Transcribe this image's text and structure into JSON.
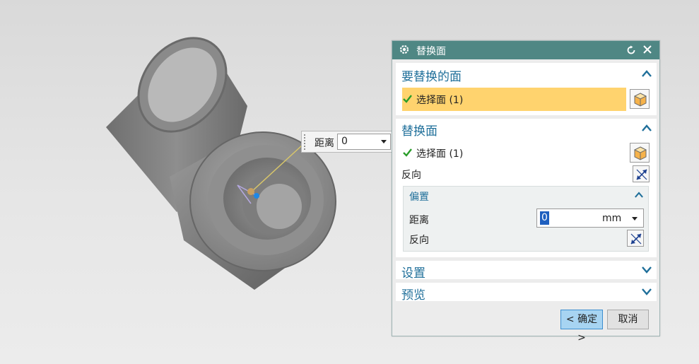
{
  "float_field": {
    "label": "距离",
    "value": "0"
  },
  "dialog": {
    "title": "替换面",
    "sections": {
      "faces_to_replace": {
        "title": "要替换的面",
        "select_label": "选择面 (1)"
      },
      "replacement_face": {
        "title": "替换面",
        "select_label": "选择面 (1)",
        "reverse_label": "反向",
        "offset": {
          "title": "偏置",
          "distance_label": "距离",
          "distance_value": "0",
          "unit": "mm",
          "reverse_label": "反向"
        }
      },
      "settings": {
        "title": "设置"
      },
      "preview": {
        "title": "预览"
      }
    },
    "buttons": {
      "ok": "< 确定 >",
      "cancel": "取消"
    }
  },
  "colors": {
    "titlebar": "#4f8784",
    "section_title": "#1f6f9a",
    "selection_highlight": "#ffd36e",
    "ok_button": "#a7d4f2"
  }
}
